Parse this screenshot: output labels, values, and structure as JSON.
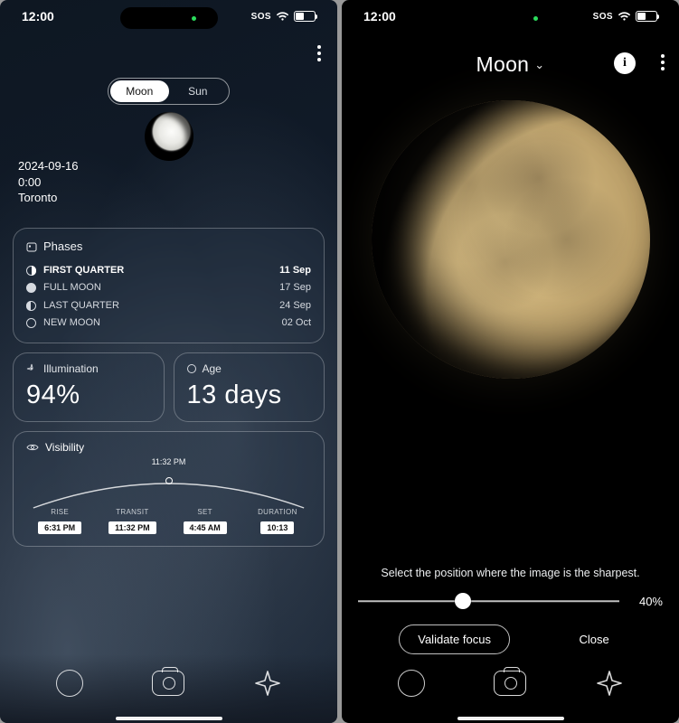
{
  "status": {
    "time": "12:00",
    "sos": "SOS"
  },
  "left": {
    "segmented": {
      "moon": "Moon",
      "sun": "Sun",
      "active": "moon"
    },
    "date": "2024-09-16",
    "time": "0:00",
    "location": "Toronto",
    "phases": {
      "title": "Phases",
      "rows": [
        {
          "key": "fq",
          "label": "FIRST QUARTER",
          "date": "11 Sep",
          "highlight": true
        },
        {
          "key": "full",
          "label": "FULL MOON",
          "date": "17 Sep",
          "highlight": false
        },
        {
          "key": "lq",
          "label": "LAST QUARTER",
          "date": "24 Sep",
          "highlight": false
        },
        {
          "key": "new",
          "label": "NEW MOON",
          "date": "02 Oct",
          "highlight": false
        }
      ]
    },
    "illumination": {
      "title": "Illumination",
      "value": "94%"
    },
    "age": {
      "title": "Age",
      "value": "13 days"
    },
    "visibility": {
      "title": "Visibility",
      "peak": "11:32 PM",
      "cells": [
        {
          "label": "RISE",
          "value": "6:31 PM"
        },
        {
          "label": "TRANSIT",
          "value": "11:32 PM"
        },
        {
          "label": "SET",
          "value": "4:45 AM"
        },
        {
          "label": "DURATION",
          "value": "10:13"
        }
      ]
    }
  },
  "right": {
    "title": "Moon",
    "focus": {
      "instruction": "Select the position where the image is the sharpest.",
      "percent": 40,
      "percent_label": "40%",
      "validate": "Validate focus",
      "close": "Close"
    }
  }
}
